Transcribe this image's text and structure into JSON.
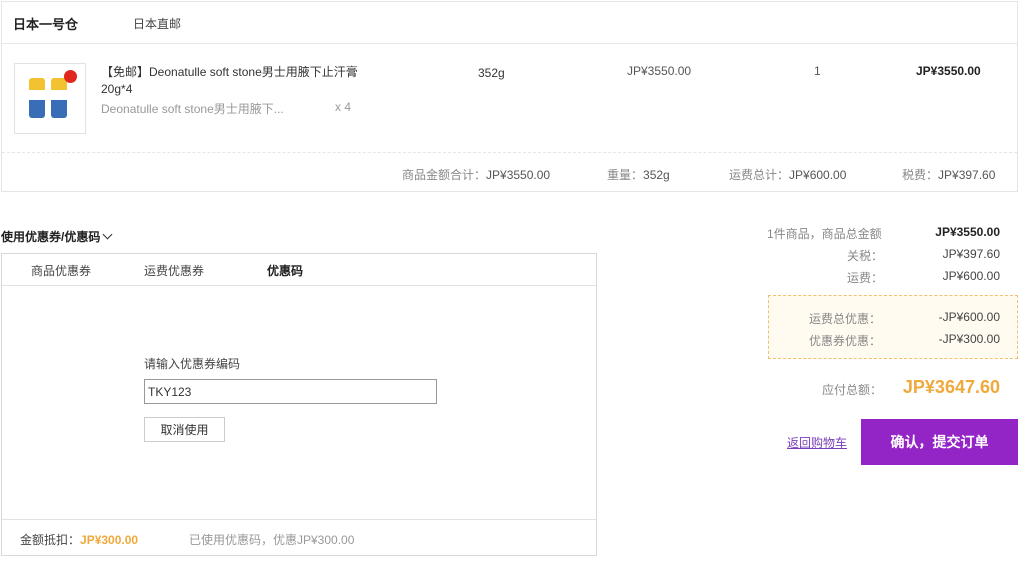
{
  "warehouse": {
    "name": "日本一号仓",
    "type": "日本直邮"
  },
  "product": {
    "title": "【免邮】Deonatulle soft stone男士用腋下止汗膏 20g*4",
    "subtitle": "Deonatulle soft stone男士用腋下...",
    "qty_sub": "x 4",
    "weight": "352g",
    "price": "JP¥3550.00",
    "quantity": "1",
    "total": "JP¥3550.00"
  },
  "summary": {
    "goods_label": "商品金额合计：",
    "goods_value": "JP¥3550.00",
    "weight_label": "重量：",
    "weight_value": "352g",
    "shipping_label": "运费总计：",
    "shipping_value": "JP¥600.00",
    "tax_label": "税费：",
    "tax_value": "JP¥397.60"
  },
  "coupon": {
    "toggle_label": "使用优惠券/优惠码",
    "tabs": [
      "商品优惠券",
      "运费优惠券",
      "优惠码"
    ],
    "active_tab": 2,
    "code_label": "请输入优惠券编码",
    "code_value": "TKY123",
    "cancel_label": "取消使用",
    "footer": {
      "deduct_label": "金额抵扣：",
      "deduct_value": "JP¥300.00",
      "used_text": "已使用优惠码，优惠JP¥300.00"
    }
  },
  "totals": {
    "items_label": "1件商品，商品总金额",
    "items_value": "JP¥3550.00",
    "tax_label": "关税：",
    "tax_value": "JP¥397.60",
    "shipping_label": "运费：",
    "shipping_value": "JP¥600.00",
    "ship_discount_label": "运费总优惠：",
    "ship_discount_value": "-JP¥600.00",
    "coupon_discount_label": "优惠券优惠：",
    "coupon_discount_value": "-JP¥300.00",
    "payable_label": "应付总额：",
    "payable_value": "JP¥3647.60"
  },
  "actions": {
    "back_label": "返回购物车",
    "submit_label": "确认，提交订单"
  },
  "colors": {
    "accent_purple": "#9325c6",
    "price_orange": "#f0a93b"
  }
}
